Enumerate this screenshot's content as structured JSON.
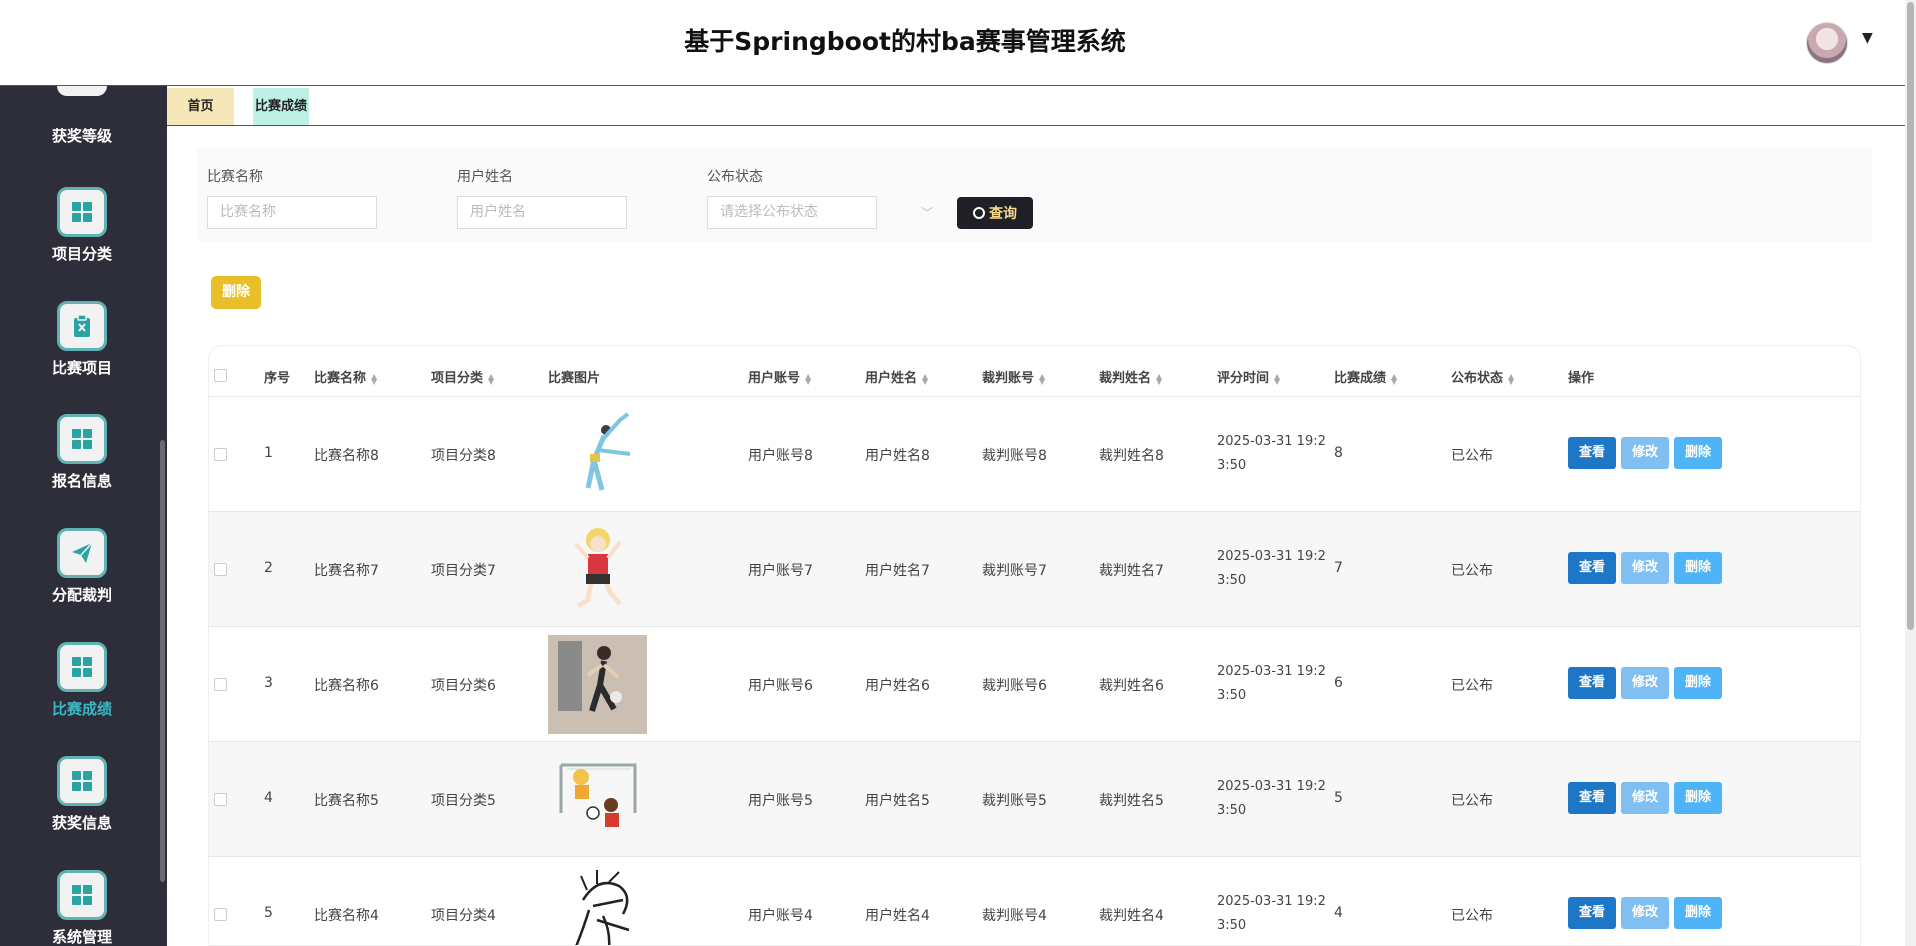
{
  "header": {
    "title": "基于Springboot的村ba赛事管理系统",
    "caret": "▼"
  },
  "sidebar": {
    "items": [
      {
        "label": "获奖等级"
      },
      {
        "label": "项目分类"
      },
      {
        "label": "比赛项目"
      },
      {
        "label": "报名信息"
      },
      {
        "label": "分配裁判"
      },
      {
        "label": "比赛成绩"
      },
      {
        "label": "获奖信息"
      },
      {
        "label": "系统管理"
      }
    ]
  },
  "tabs": [
    {
      "label": "首页"
    },
    {
      "label": "比赛成绩"
    }
  ],
  "search": {
    "name_label": "比赛名称",
    "name_placeholder": "比赛名称",
    "user_label": "用户姓名",
    "user_placeholder": "用户姓名",
    "status_label": "公布状态",
    "status_placeholder": "请选择公布状态",
    "search_button": "查询"
  },
  "toolbar": {
    "delete_label": "删除"
  },
  "table": {
    "headers": [
      "序号",
      "比赛名称",
      "项目分类",
      "比赛图片",
      "用户账号",
      "用户姓名",
      "裁判账号",
      "裁判姓名",
      "评分时间",
      "比赛成绩",
      "公布状态",
      "操作"
    ],
    "rows": [
      {
        "index": "1",
        "name": "比赛名称8",
        "category": "项目分类8",
        "account": "用户账号8",
        "username": "用户姓名8",
        "judge_account": "裁判账号8",
        "judge_name": "裁判姓名8",
        "time": "2025-03-31 19:23:50",
        "score": "8",
        "status": "已公布"
      },
      {
        "index": "2",
        "name": "比赛名称7",
        "category": "项目分类7",
        "account": "用户账号7",
        "username": "用户姓名7",
        "judge_account": "裁判账号7",
        "judge_name": "裁判姓名7",
        "time": "2025-03-31 19:23:50",
        "score": "7",
        "status": "已公布"
      },
      {
        "index": "3",
        "name": "比赛名称6",
        "category": "项目分类6",
        "account": "用户账号6",
        "username": "用户姓名6",
        "judge_account": "裁判账号6",
        "judge_name": "裁判姓名6",
        "time": "2025-03-31 19:23:50",
        "score": "6",
        "status": "已公布"
      },
      {
        "index": "4",
        "name": "比赛名称5",
        "category": "项目分类5",
        "account": "用户账号5",
        "username": "用户姓名5",
        "judge_account": "裁判账号5",
        "judge_name": "裁判姓名5",
        "time": "2025-03-31 19:23:50",
        "score": "5",
        "status": "已公布"
      },
      {
        "index": "5",
        "name": "比赛名称4",
        "category": "项目分类4",
        "account": "用户账号4",
        "username": "用户姓名4",
        "judge_account": "裁判账号4",
        "judge_name": "裁判姓名4",
        "time": "2025-03-31 19:23:50",
        "score": "4",
        "status": "已公布"
      }
    ],
    "actions": {
      "view": "查看",
      "edit": "修改",
      "delete": "删除"
    }
  },
  "colors": {
    "sidebar_bg": "#2e2e3a",
    "active_nav": "#3cb8c4",
    "view_btn": "#1d76c6",
    "batch_delete": "#e8bf28"
  }
}
